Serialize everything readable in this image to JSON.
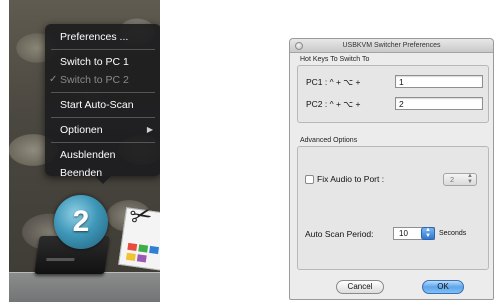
{
  "context_menu": {
    "items": [
      {
        "label": "Preferences ...",
        "enabled": true
      },
      {
        "label": "Switch to PC 1",
        "enabled": true
      },
      {
        "label": "Switch to PC 2",
        "enabled": false,
        "checked": true
      },
      {
        "label": "Start Auto-Scan",
        "enabled": true
      },
      {
        "label": "Optionen",
        "enabled": true,
        "submenu": true
      },
      {
        "label": "Ausblenden",
        "enabled": true
      },
      {
        "label": "Beenden",
        "enabled": true
      }
    ],
    "checkmark": "✓",
    "submenu_arrow": "▶"
  },
  "dock": {
    "badge_number": "2",
    "icons": [
      "usb-kvm-switcher-icon",
      "snipping-tool-icon"
    ]
  },
  "prefs": {
    "window_title": "USBKVM Switcher Preferences",
    "hotkeys_section": "Hot Keys To Switch To",
    "pc1_label": "PC1 : ^ + ⌥ +",
    "pc1_value": "1",
    "pc2_label": "PC2 : ^ + ⌥ +",
    "pc2_value": "2",
    "advanced_section": "Advanced Options",
    "fix_audio_label": "Fix Audio to Port :",
    "fix_audio_checked": false,
    "audio_port_value": "2",
    "scan_period_label": "Auto Scan Period:",
    "scan_period_value": "10",
    "scan_period_unit": "Seconds",
    "cancel_label": "Cancel",
    "ok_label": "OK"
  },
  "colors": {
    "menu_bg": "#1c1c1e",
    "window_bg": "#ececec",
    "default_button": "#5fa4ea",
    "badge": "#3f97b8"
  }
}
